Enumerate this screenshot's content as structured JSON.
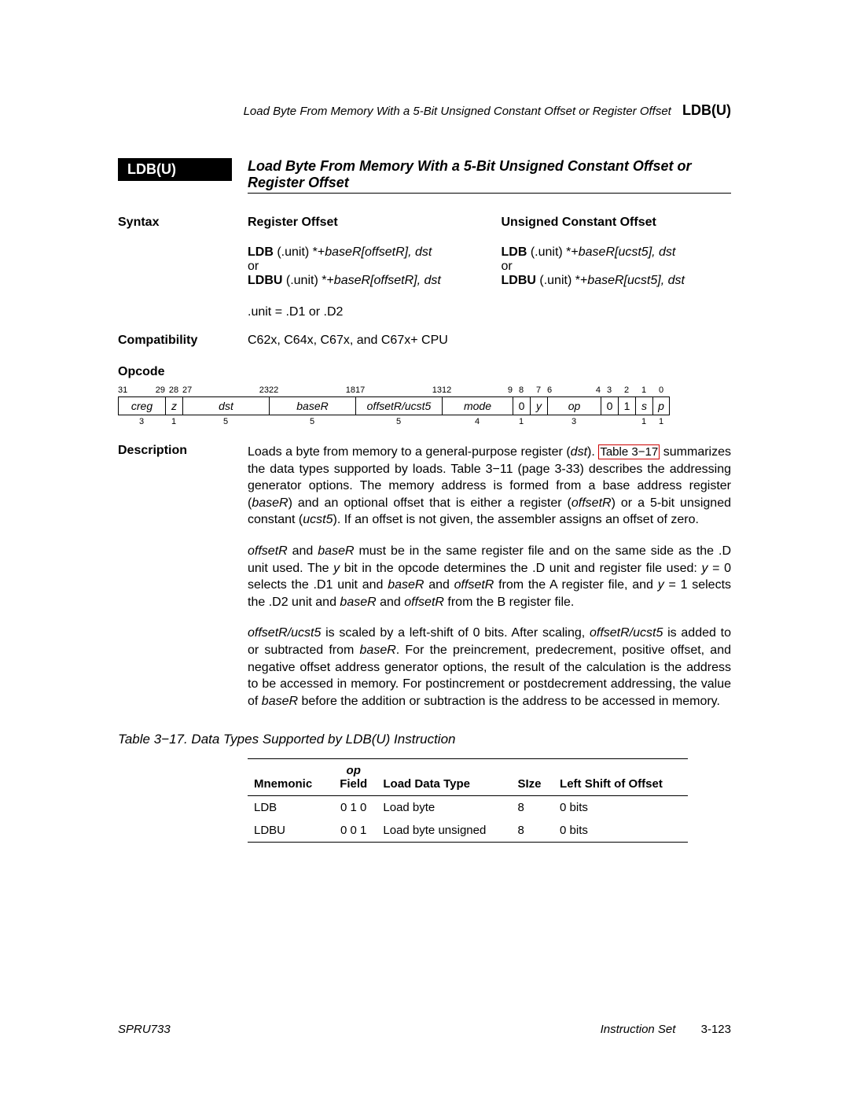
{
  "running_head": {
    "text": "Load Byte From Memory With a 5-Bit Unsigned Constant Offset or Register Offset",
    "tag": "LDB(U)"
  },
  "instr": {
    "badge": "LDB(U)",
    "title": "Load Byte From Memory With a 5-Bit Unsigned Constant Offset or Register Offset"
  },
  "syntax": {
    "label": "Syntax",
    "reg": {
      "heading": "Register Offset",
      "l1_b": "LDB",
      "l1_r": " (.unit) *+",
      "l1_i": "baseR[offsetR]",
      "l1_e": ", dst",
      "or": "or",
      "l2_b": "LDBU",
      "l2_r": " (.unit) *+",
      "l2_i": "baseR[offsetR]",
      "l2_e": ", dst"
    },
    "uoff": {
      "heading": "Unsigned Constant Offset",
      "l1_b": "LDB",
      "l1_r": " (.unit) *+",
      "l1_i": "baseR[ucst5]",
      "l1_e": ", dst",
      "or": "or",
      "l2_b": "LDBU",
      "l2_r": " (.unit) *+",
      "l2_i": "baseR[ucst5]",
      "l2_e": ", dst"
    },
    "unit": ".unit = .D1 or .D2"
  },
  "compat": {
    "label": "Compatibility",
    "text": "C62x, C64x, C67x, and C67x+ CPU"
  },
  "opcode": {
    "label": "Opcode",
    "top": [
      "31",
      "29",
      "28",
      "27",
      "",
      "23",
      "22",
      "",
      "18",
      "17",
      "",
      "13",
      "12",
      "",
      "9",
      "8",
      "7",
      "6",
      "",
      "4",
      "3",
      "2",
      "1",
      "0"
    ],
    "fields": {
      "creg": "creg",
      "z": "z",
      "dst": "dst",
      "baseR": "baseR",
      "off": "offsetR/ucst5",
      "mode": "mode",
      "r": "0",
      "y": "y",
      "op": "op",
      "c01": "0",
      "c1": "1",
      "s": "s",
      "p": "p"
    },
    "widths": {
      "creg": "3",
      "z": "1",
      "dst": "5",
      "baseR": "5",
      "off": "5",
      "mode": "4",
      "r": "1",
      "op": "3",
      "s": "1",
      "p": "1"
    }
  },
  "desc": {
    "label": "Description",
    "p1a": "Loads a byte from memory to a general-purpose register (",
    "p1b": "dst",
    "p1c": ").",
    "link": "Table 3−17",
    "p1d": " summarizes the data types supported by loads. Table 3−11 (page 3-33) describes the addressing generator options. The memory address is formed from a base address register (",
    "p1e": "baseR",
    "p1f": ") and an optional offset that is either a register (",
    "p1g": "offsetR",
    "p1h": ") or a 5-bit unsigned constant (",
    "p1i": "ucst5",
    "p1j": "). If an offset is not given, the assembler assigns an offset of zero.",
    "p2": "offsetR and baseR must be in the same register file and on the same side as the .D unit used. The y bit in the opcode determines the .D unit and register file used: y = 0 selects the .D1 unit and baseR and offsetR from the A register file, and y = 1 selects the .D2 unit and baseR and offsetR from the B register file.",
    "p3": "offsetR/ucst5 is scaled by a left-shift of 0 bits. After scaling, offsetR/ucst5 is added to or subtracted from baseR. For the preincrement, predecrement, positive offset, and negative offset address generator options, the result of the calculation is the address to be accessed in memory. For postincrement or postdecrement addressing, the value of baseR before the addition or subtraction is the address to be accessed in memory."
  },
  "table": {
    "caption": "Table 3−17.  Data Types Supported by LDB(U) Instruction",
    "head": {
      "mn": "Mnemonic",
      "op1": "op",
      "op2": "Field",
      "ld": "Load Data Type",
      "sz": "SIze",
      "ls": "Left Shift of Offset"
    },
    "rows": [
      {
        "mn": "LDB",
        "opf": "0 1 0",
        "ld": "Load byte",
        "sz": "8",
        "ls": "0 bits"
      },
      {
        "mn": "LDBU",
        "opf": "0 0 1",
        "ld": "Load byte unsigned",
        "sz": "8",
        "ls": "0 bits"
      }
    ]
  },
  "footer": {
    "left": "SPRU733",
    "mid": "Instruction Set",
    "pn": "3-123"
  }
}
